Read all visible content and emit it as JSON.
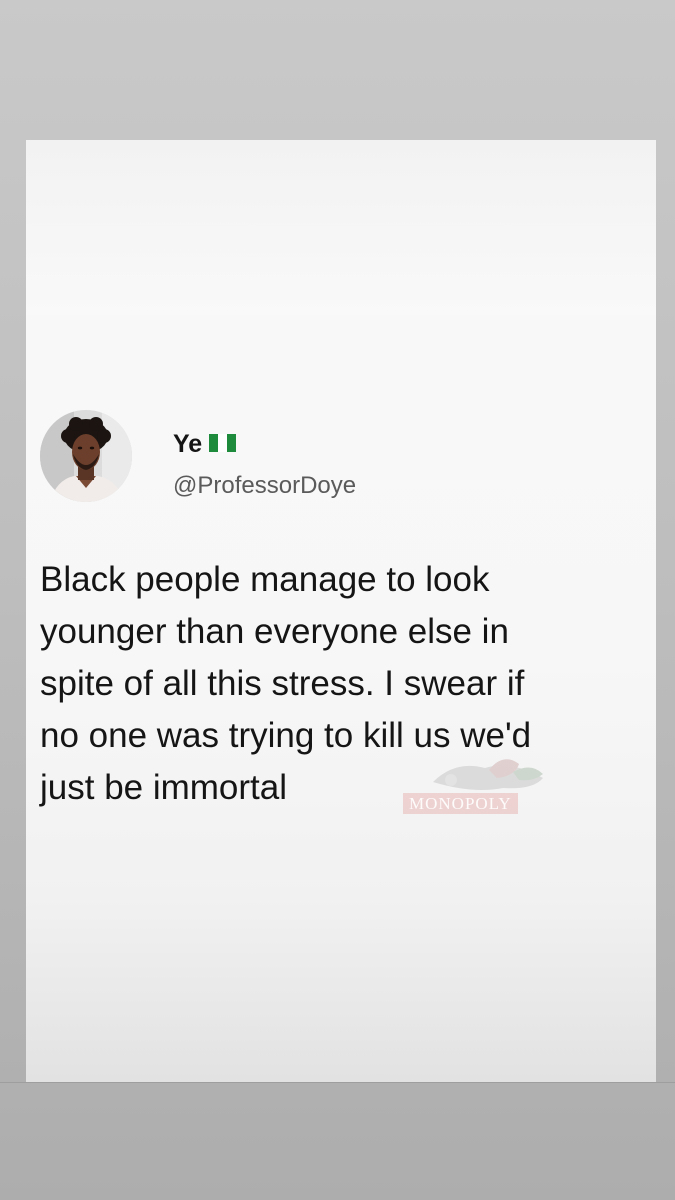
{
  "post": {
    "display_name": "Ye",
    "flag_icon": "nigeria-flag-icon",
    "handle": "@ProfessorDoye",
    "avatar_icon": "profile-photo",
    "text_lines": [
      "Black people manage to look",
      "younger than everyone else in",
      "spite of all this stress. I swear if",
      "no one was trying to kill us we'd",
      "just be immortal"
    ]
  },
  "watermark": {
    "text": "MONOPOLY"
  },
  "colors": {
    "flag_green": "#1e8a3c",
    "flag_white": "#ffffff",
    "text_primary": "#151515",
    "text_secondary": "#5a5a5a",
    "card_background": "#f7f7f7",
    "frame_background": "#b3b3b3"
  }
}
